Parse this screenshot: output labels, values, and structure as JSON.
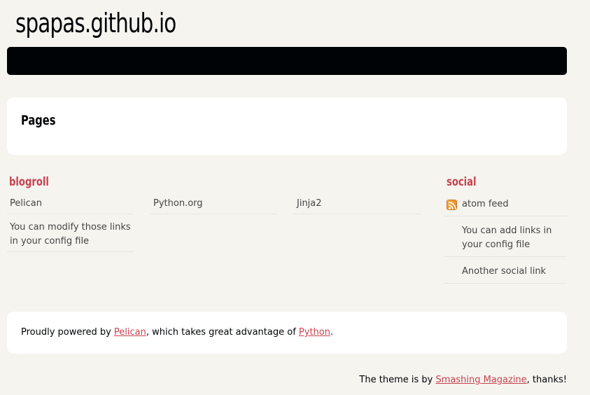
{
  "header": {
    "site_title": "spapas.github.io"
  },
  "pages_section": {
    "title": "Pages"
  },
  "blogroll": {
    "heading": "blogroll",
    "columns": [
      [
        "Pelican",
        "You can modify those links in your config file"
      ],
      [
        "Python.org"
      ],
      [
        "Jinja2"
      ]
    ]
  },
  "social": {
    "heading": "social",
    "items": [
      {
        "label": "atom feed",
        "icon": "rss-feed-icon"
      },
      {
        "label": "You can add links in your config file"
      },
      {
        "label": "Another social link"
      }
    ]
  },
  "footer": {
    "text_before": "Proudly powered by ",
    "pelican_link": "Pelican",
    "text_middle": ", which takes great advantage of ",
    "python_link": "Python",
    "text_after": "."
  },
  "credit": {
    "text_before": "The theme is by ",
    "link": "Smashing Magazine",
    "text_after": ", thanks!"
  },
  "colors": {
    "background": "#f5f4ef",
    "navbar": "#000305",
    "accent": "#c74350",
    "panel": "#ffffff"
  }
}
